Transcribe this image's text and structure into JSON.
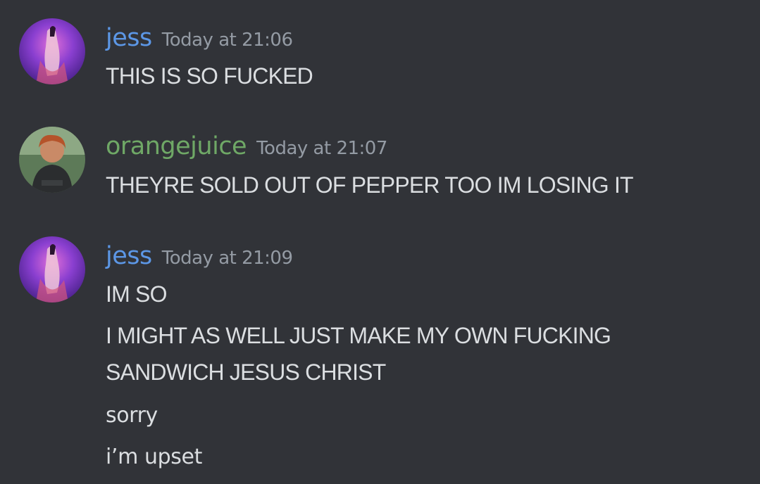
{
  "colors": {
    "background": "#313338",
    "text": "#dbdee1",
    "timestamp": "#949ba4",
    "jess_name": "#5c97e6",
    "orangejuice_name": "#6fa866"
  },
  "messages": [
    {
      "author": "jess",
      "timestamp": "Today at 21:06",
      "avatar": "jess-avatar",
      "lines": [
        "THIS IS SO FUCKED"
      ]
    },
    {
      "author": "orangejuice",
      "timestamp": "Today at 21:07",
      "avatar": "orangejuice-avatar",
      "lines": [
        "THEYRE SOLD OUT OF PEPPER TOO IM LOSING IT"
      ]
    },
    {
      "author": "jess",
      "timestamp": "Today at 21:09",
      "avatar": "jess-avatar",
      "lines": [
        "IM SO",
        "I MIGHT AS WELL JUST MAKE MY OWN FUCKING",
        "SANDWICH JESUS CHRIST",
        "sorry",
        "i’m upset"
      ]
    }
  ]
}
